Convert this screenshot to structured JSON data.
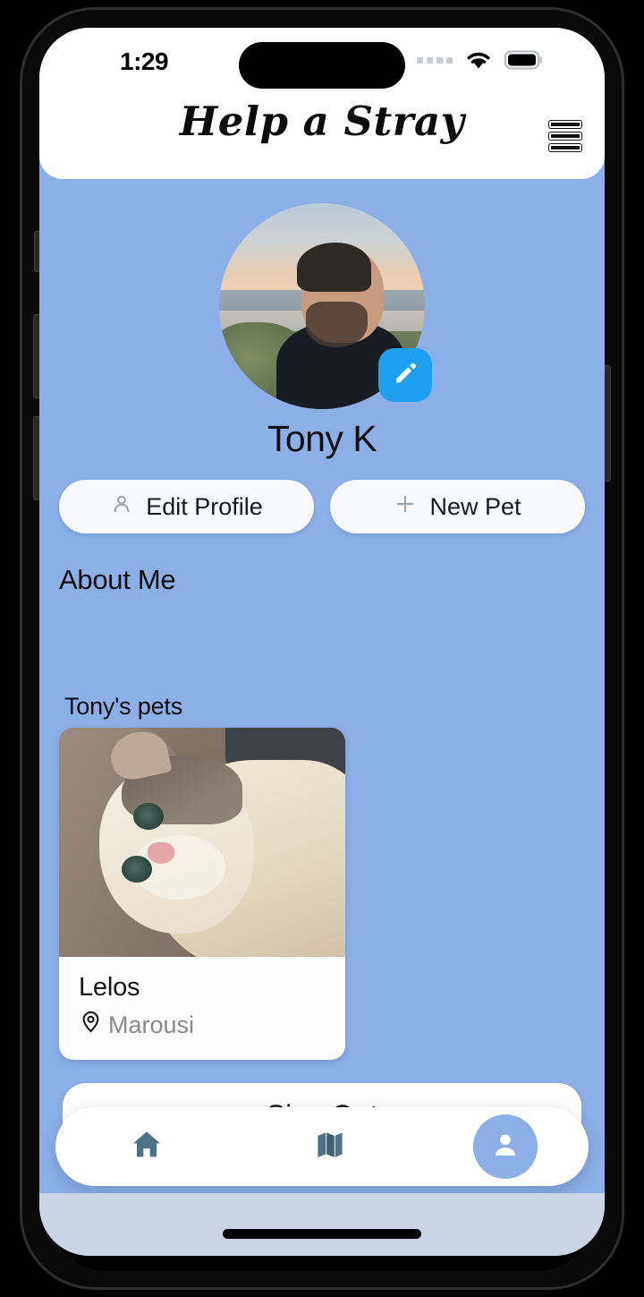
{
  "status_bar": {
    "time": "1:29",
    "signal_icon": "signal-dots-icon",
    "wifi_icon": "wifi-icon",
    "battery_icon": "battery-full-icon"
  },
  "header": {
    "app_title": "Help a Stray",
    "menu_icon": "hamburger-menu-icon"
  },
  "profile": {
    "name": "Tony K",
    "avatar_alt": "profile-photo",
    "edit_avatar_icon": "pencil-icon"
  },
  "actions": [
    {
      "label": "Edit Profile",
      "icon": "person-icon"
    },
    {
      "label": "New Pet",
      "icon": "plus-icon"
    }
  ],
  "about": {
    "title": "About Me",
    "body": ""
  },
  "pets": {
    "section_label": "Tony's pets",
    "items": [
      {
        "name": "Lelos",
        "location": "Marousi",
        "location_icon": "map-pin-icon",
        "photo_alt": "cat-photo"
      }
    ]
  },
  "sign_out": {
    "label": "Sign Out"
  },
  "bottom_nav": {
    "items": [
      {
        "name": "home",
        "icon": "home-icon",
        "active": false
      },
      {
        "name": "map",
        "icon": "map-icon",
        "active": false
      },
      {
        "name": "profile",
        "icon": "person-icon",
        "active": true
      }
    ]
  },
  "colors": {
    "background": "#8cafe8",
    "card": "#ffffff",
    "accent_blue": "#1ea0f0",
    "nav_icon": "#4f7188",
    "muted_text": "#8a8a8a"
  },
  "home_indicator": "home-indicator"
}
